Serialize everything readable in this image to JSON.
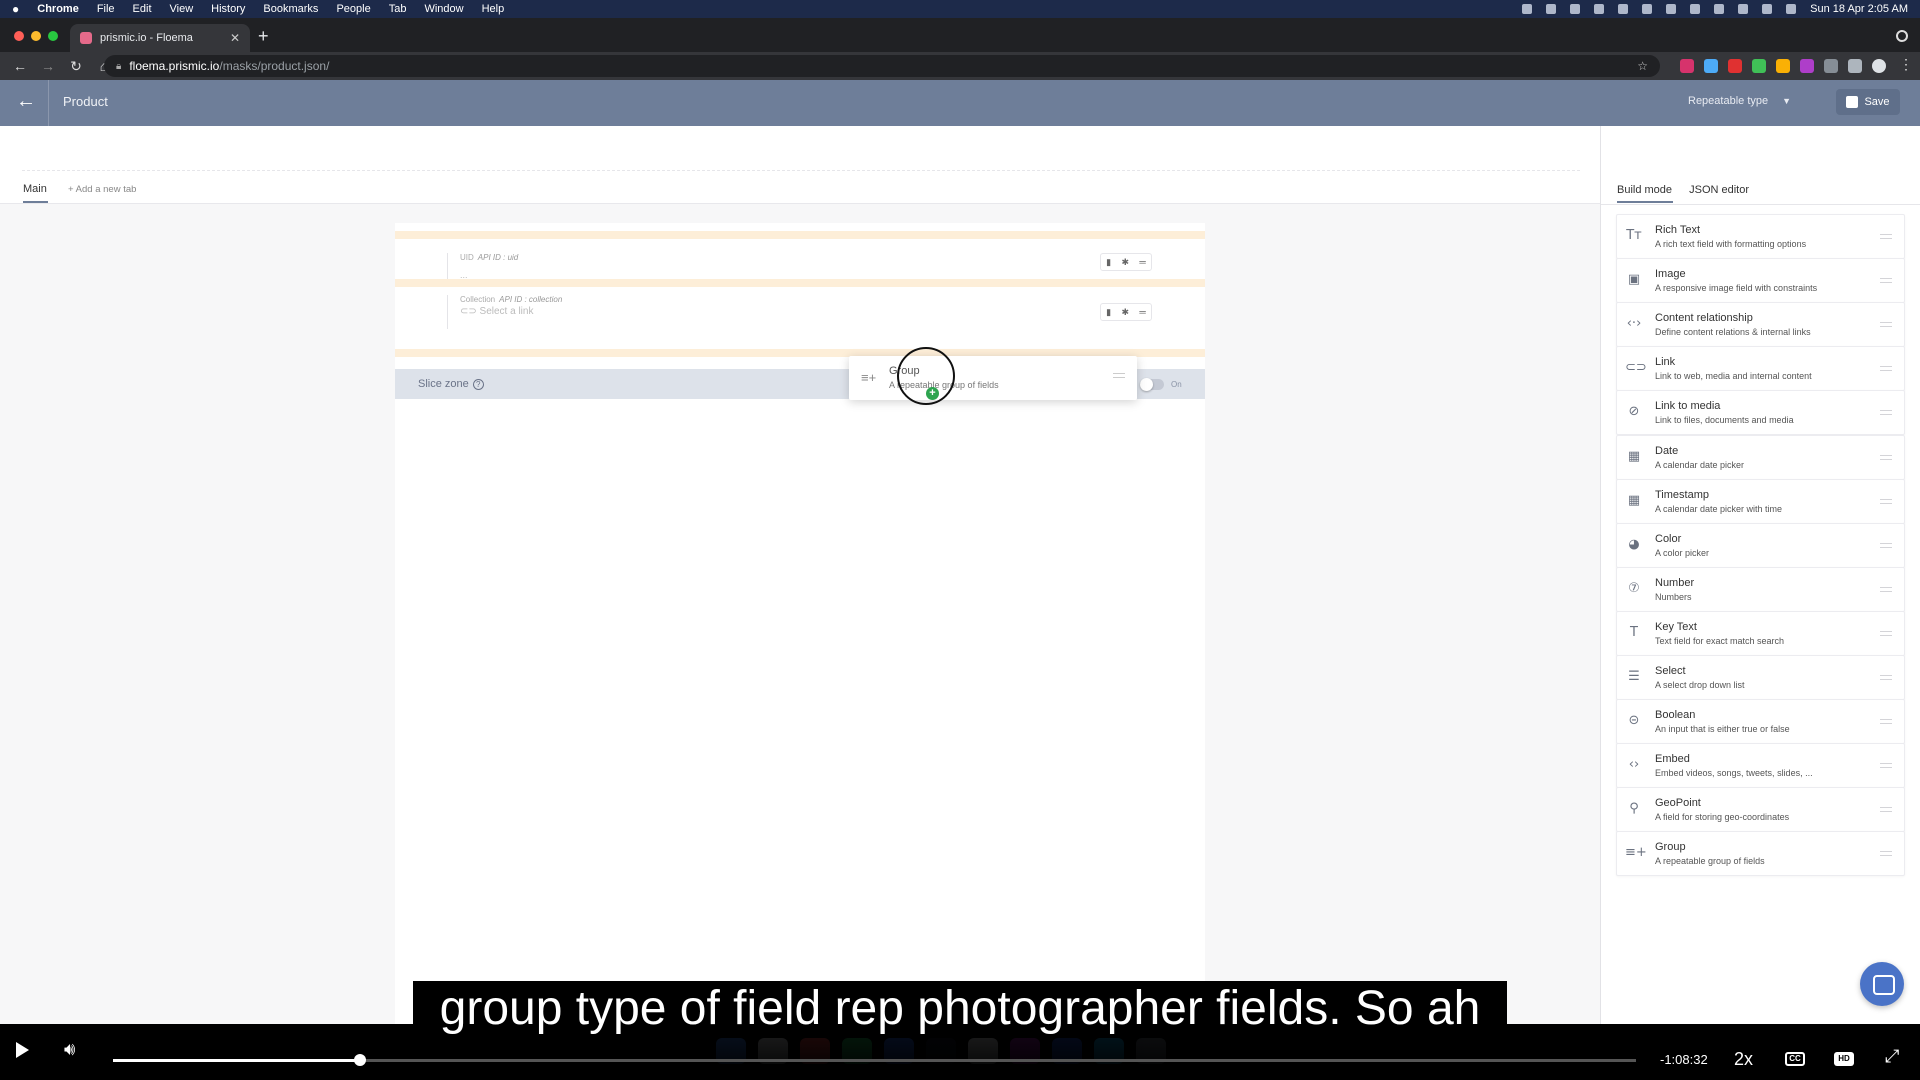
{
  "menubar": {
    "app": "Chrome",
    "menus": [
      "File",
      "Edit",
      "View",
      "History",
      "Bookmarks",
      "People",
      "Tab",
      "Window",
      "Help"
    ],
    "clock": "Sun 18 Apr  2:05 AM"
  },
  "browser": {
    "tab_title": "prismic.io - Floema",
    "url_host": "floema.prismic.io",
    "url_path": "/masks/product.json/"
  },
  "app_header": {
    "title": "Product",
    "type_selector": "Repeatable type",
    "save_label": "Save"
  },
  "editor": {
    "tabs": {
      "main": "Main",
      "add": "+ Add a new tab"
    },
    "fields": [
      {
        "label": "UID",
        "api_id": "API ID : uid",
        "value": "..."
      },
      {
        "label": "Collection",
        "api_id": "API ID : collection",
        "value": "Select a link"
      }
    ],
    "slice_zone": {
      "label": "Slice zone",
      "help": "?",
      "toggle_label": "On"
    }
  },
  "drag_preview": {
    "title": "Group",
    "desc": "A repeatable group of fields"
  },
  "sidebar": {
    "tabs": {
      "build": "Build mode",
      "json": "JSON editor"
    },
    "widgets": [
      {
        "icon": "rich-text-icon",
        "glyph": "Tт",
        "title": "Rich Text",
        "desc": "A rich text field with formatting options"
      },
      {
        "icon": "image-icon",
        "glyph": "▣",
        "title": "Image",
        "desc": "A responsive image field with constraints"
      },
      {
        "icon": "content-relationship-icon",
        "glyph": "‹·›",
        "title": "Content relationship",
        "desc": "Define content relations & internal links"
      },
      {
        "icon": "link-icon",
        "glyph": "⊂⊃",
        "title": "Link",
        "desc": "Link to web, media and internal content"
      },
      {
        "icon": "link-to-media-icon",
        "glyph": "⊘",
        "title": "Link to media",
        "desc": "Link to files, documents and media"
      },
      {
        "icon": "date-icon",
        "glyph": "▦",
        "title": "Date",
        "desc": "A calendar date picker"
      },
      {
        "icon": "timestamp-icon",
        "glyph": "▦",
        "title": "Timestamp",
        "desc": "A calendar date picker with time"
      },
      {
        "icon": "color-icon",
        "glyph": "◕",
        "title": "Color",
        "desc": "A color picker"
      },
      {
        "icon": "number-icon",
        "glyph": "⑦",
        "title": "Number",
        "desc": "Numbers"
      },
      {
        "icon": "key-text-icon",
        "glyph": "T",
        "title": "Key Text",
        "desc": "Text field for exact match search"
      },
      {
        "icon": "select-icon",
        "glyph": "☰",
        "title": "Select",
        "desc": "A select drop down list"
      },
      {
        "icon": "boolean-icon",
        "glyph": "⊝",
        "title": "Boolean",
        "desc": "An input that is either true or false"
      },
      {
        "icon": "embed-icon",
        "glyph": "‹›",
        "title": "Embed",
        "desc": "Embed videos, songs, tweets, slides, ..."
      },
      {
        "icon": "geopoint-icon",
        "glyph": "⚲",
        "title": "GeoPoint",
        "desc": "A field for storing geo-coordinates"
      },
      {
        "icon": "group-icon",
        "glyph": "≡+",
        "title": "Group",
        "desc": "A repeatable group of fields"
      }
    ]
  },
  "video": {
    "caption": "group type of field rep photographer fields. So ah",
    "time_remaining": "-1:08:32",
    "speed": "2x",
    "progress": 0.162,
    "cc": "CC",
    "hd": "HD"
  }
}
